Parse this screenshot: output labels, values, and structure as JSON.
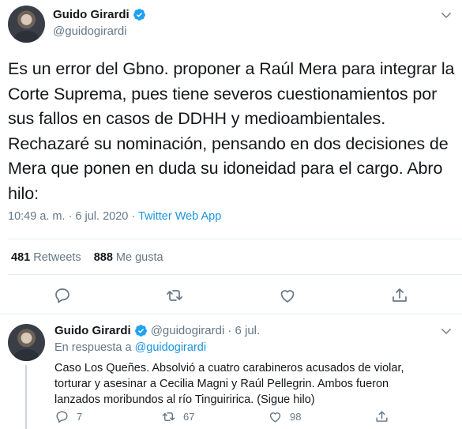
{
  "main": {
    "author": {
      "name": "Guido Girardi",
      "handle": "@guidogirardi"
    },
    "text": "Es un error del Gbno. proponer a Raúl Mera para integrar la Corte Suprema, pues tiene severos cuestionamientos por sus fallos en casos de DDHH y medioambientales. Rechazaré su nominación, pensando en dos decisiones de Mera que ponen en duda su idoneidad para el cargo. Abro hilo:",
    "timestamp": "10:49 a. m. · 6 jul. 2020 · ",
    "source": "Twitter Web App",
    "stats": {
      "retweets_count": "481",
      "retweets_label": "Retweets",
      "likes_count": "888",
      "likes_label": "Me gusta"
    },
    "actions": [
      "reply-icon",
      "retweet-icon",
      "like-icon",
      "share-icon"
    ]
  },
  "reply": {
    "author": {
      "name": "Guido Girardi",
      "handle": "@guidogirardi",
      "date": "· 6 jul."
    },
    "in_reply_prefix": "En respuesta a ",
    "in_reply_handle": "@guidogirardi",
    "text": "Caso Los Queñes. Absolvió a cuatro carabineros acusados de violar, torturar y asesinar a Cecilia Magni y Raúl Pellegrin. Ambos fueron lanzados moribundos al río Tinguiririca.  (Sigue hilo)",
    "counts": {
      "replies": "7",
      "retweets": "67",
      "likes": "98"
    }
  },
  "colors": {
    "accent": "#1da1f2",
    "link": "#1b95e0",
    "muted": "#657786",
    "text": "#14171a",
    "border": "#e6ecf0"
  }
}
